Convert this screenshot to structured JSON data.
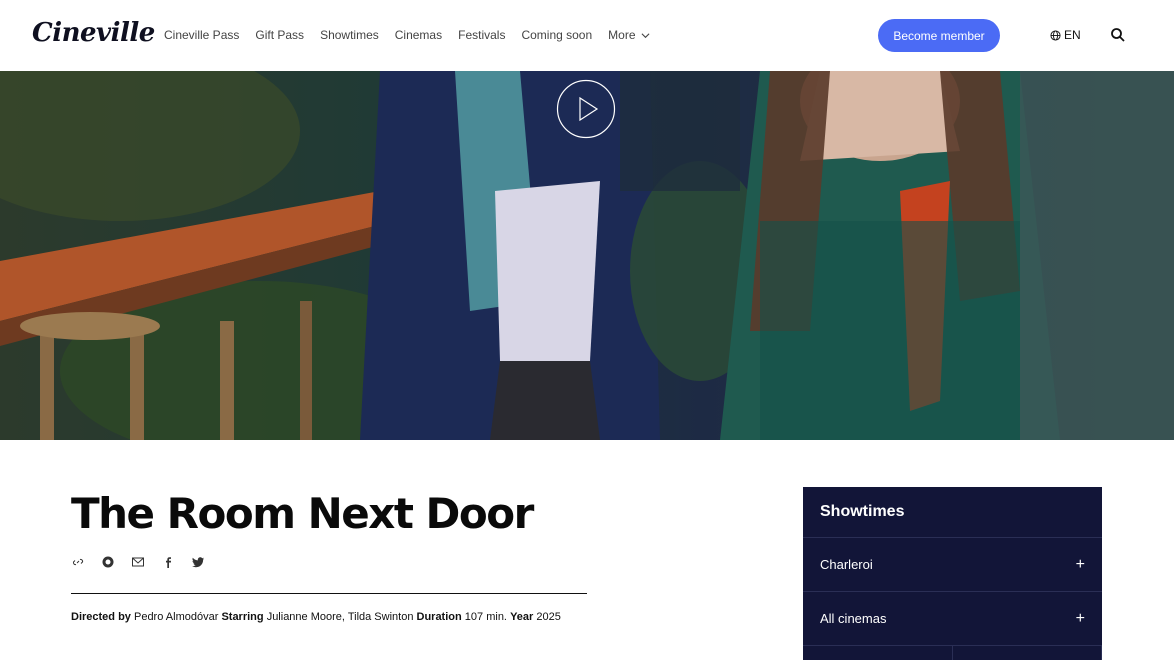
{
  "header": {
    "logo": "Cineville",
    "nav": [
      "Cineville Pass",
      "Gift Pass",
      "Showtimes",
      "Cinemas",
      "Festivals",
      "Coming soon",
      "More"
    ],
    "member_button": "Become member",
    "language": "EN"
  },
  "hero": {
    "play_icon": "play-icon"
  },
  "film": {
    "title": "The Room Next Door",
    "share_icons": [
      "link-icon",
      "whatsapp-icon",
      "mail-icon",
      "facebook-icon",
      "twitter-icon"
    ],
    "directed_label": "Directed by",
    "director": "Pedro Almodóvar",
    "starring_label": "Starring",
    "cast": "Julianne Moore, Tilda Swinton",
    "duration_label": "Duration",
    "duration": "107 min.",
    "year_label": "Year",
    "year": "2025"
  },
  "showtimes": {
    "title": "Showtimes",
    "rows": [
      "Charleroi",
      "All cinemas"
    ]
  },
  "colors": {
    "accent": "#4b6bf5",
    "panel": "#121538"
  }
}
